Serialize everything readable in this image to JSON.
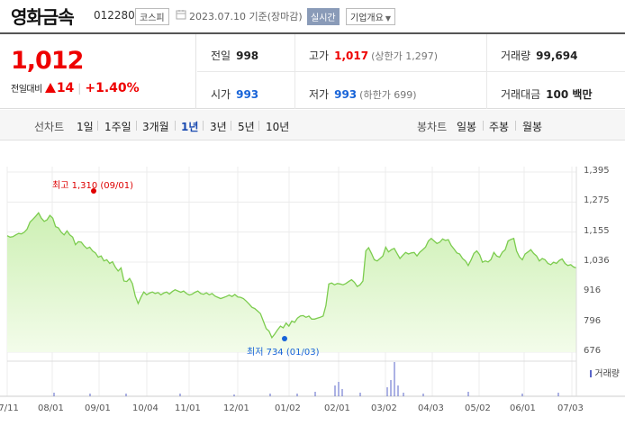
{
  "header": {
    "name": "영화금속",
    "code": "012280",
    "market": "코스피",
    "date_text": "2023.07.10  기준(장마감)",
    "realtime_label": "실시간",
    "company_label": "기업개요"
  },
  "summary": {
    "price": "1,012",
    "change_label": "전일대비",
    "change_amount": "14",
    "change_percent": "+1.40%",
    "prev_close": {
      "label": "전일",
      "value": "998"
    },
    "high": {
      "label": "고가",
      "value": "1,017",
      "sub": "(상한가 1,297)"
    },
    "volume": {
      "label": "거래량",
      "value": "99,694"
    },
    "open": {
      "label": "시가",
      "value": "993"
    },
    "low": {
      "label": "저가",
      "value": "993",
      "sub": "(하한가 699)"
    },
    "amount": {
      "label": "거래대금",
      "value": "100 백만"
    }
  },
  "periods": {
    "line_label": "선차트",
    "line_items": [
      "1일",
      "1주일",
      "3개월",
      "1년",
      "3년",
      "5년",
      "10년"
    ],
    "selected": "1년",
    "candle_label": "봉차트",
    "candle_items": [
      "일봉",
      "주봉",
      "월봉"
    ]
  },
  "colors": {
    "up": "#e00000",
    "down": "#1763d8",
    "line": "#7ccc4e",
    "fill_top": "#cdf0b4",
    "fill_bottom": "#f3fcea",
    "volume": "#5a66c8"
  },
  "chart_data": {
    "type": "area",
    "ylim": [
      676,
      1395
    ],
    "yticks": [
      "1,395",
      "1,275",
      "1,155",
      "1,036",
      "916",
      "796",
      "676"
    ],
    "xticks": [
      "07/11",
      "08/01",
      "09/01",
      "10/04",
      "11/01",
      "12/01",
      "01/02",
      "02/01",
      "03/02",
      "04/03",
      "05/02",
      "06/01",
      "07/03"
    ],
    "high_annotation": "최고 1,310 (09/01)",
    "low_annotation": "최저 734 (01/03)",
    "volume_legend": "거래량",
    "price_series": [
      1141,
      1135,
      1137,
      1144,
      1150,
      1148,
      1155,
      1167,
      1195,
      1206,
      1218,
      1232,
      1211,
      1198,
      1204,
      1222,
      1211,
      1177,
      1172,
      1155,
      1144,
      1160,
      1144,
      1135,
      1105,
      1117,
      1115,
      1101,
      1090,
      1095,
      1080,
      1072,
      1055,
      1060,
      1040,
      1045,
      1030,
      1037,
      1015,
      1000,
      1012,
      960,
      958,
      970,
      950,
      900,
      870,
      895,
      916,
      905,
      912,
      916,
      910,
      914,
      905,
      912,
      916,
      908,
      918,
      925,
      920,
      915,
      920,
      910,
      904,
      908,
      915,
      920,
      910,
      907,
      913,
      905,
      910,
      900,
      895,
      890,
      894,
      898,
      904,
      898,
      906,
      896,
      895,
      890,
      880,
      868,
      855,
      850,
      840,
      830,
      800,
      770,
      760,
      734,
      748,
      765,
      780,
      773,
      792,
      780,
      800,
      795,
      812,
      820,
      822,
      815,
      820,
      808,
      808,
      812,
      815,
      820,
      862,
      948,
      952,
      945,
      950,
      948,
      945,
      950,
      958,
      965,
      955,
      938,
      945,
      960,
      1080,
      1093,
      1070,
      1045,
      1040,
      1050,
      1060,
      1095,
      1076,
      1085,
      1090,
      1070,
      1050,
      1062,
      1074,
      1068,
      1072,
      1074,
      1060,
      1075,
      1085,
      1095,
      1120,
      1130,
      1120,
      1110,
      1115,
      1128,
      1122,
      1125,
      1102,
      1088,
      1072,
      1068,
      1050,
      1040,
      1022,
      1044,
      1070,
      1080,
      1065,
      1035,
      1040,
      1036,
      1046,
      1074,
      1060,
      1055,
      1075,
      1085,
      1120,
      1126,
      1130,
      1080,
      1056,
      1045,
      1068,
      1076,
      1085,
      1070,
      1060,
      1040,
      1050,
      1045,
      1030,
      1025,
      1035,
      1030,
      1042,
      1048,
      1030,
      1022,
      1025,
      1016,
      1012
    ]
  }
}
